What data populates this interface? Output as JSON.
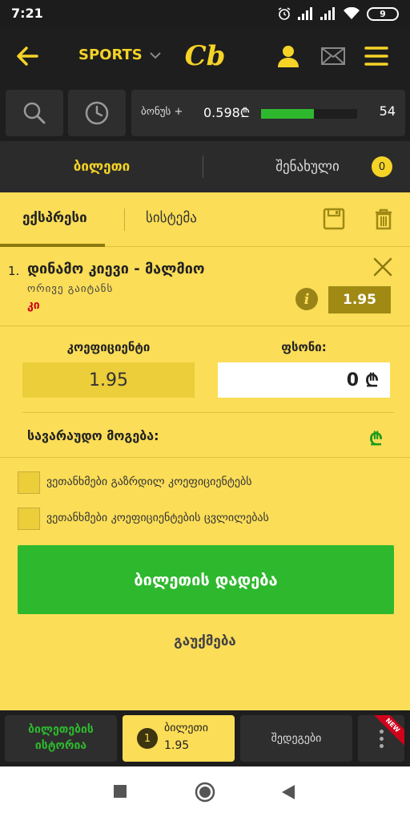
{
  "status_bar": {
    "time": "7:21",
    "battery": "9"
  },
  "header": {
    "sports_label": "SPORTS",
    "logo_text": "Cb"
  },
  "bonus": {
    "label": "ბონუს +",
    "value": "0.598₾",
    "progress": 0.55,
    "count": "54"
  },
  "tabs": {
    "ticket_label": "ბილეთი",
    "saved_label": "შენახული",
    "saved_count": "0"
  },
  "ticket_types": {
    "express_label": "ექსპრესი",
    "system_label": "სისტემა"
  },
  "bet": {
    "index": "1.",
    "match": "დინამო კიევი - მალმიო",
    "market": "ორივე გაიტანს",
    "pick": "კი",
    "odds": "1.95",
    "info_glyph": "i"
  },
  "form": {
    "coef_label": "კოეფიციენტი",
    "coef_value": "1.95",
    "stake_label": "ფსონი:",
    "stake_value": "0",
    "currency": "₾",
    "potential_win_label": "სავარაუდო მოგება:"
  },
  "checkboxes": [
    {
      "label": "ვეთანხმები გაზრდილ კოეფიციენტებს",
      "checked": false
    },
    {
      "label": "ვეთანხმები კოეფიციენტების ცვლილებას",
      "checked": false
    }
  ],
  "actions": {
    "place_bet_label": "ბილეთის დადება",
    "cancel_label": "გაუქმება"
  },
  "bottom_nav": {
    "history_line1": "ბილეთების",
    "history_line2": "ისტორია",
    "ticket_count": "1",
    "ticket_label": "ბილეთი",
    "ticket_odds": "1.95",
    "results_label": "შედეგები",
    "new_badge": "NEW"
  },
  "colors": {
    "accent_yellow": "#fbdd57",
    "brand_yellow": "#f5d327",
    "green": "#2eb82e",
    "dark": "#1e1e1e"
  }
}
